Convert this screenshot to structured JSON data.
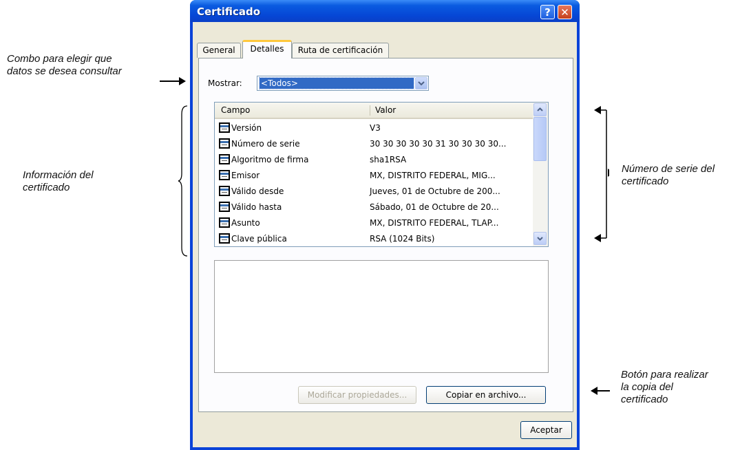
{
  "window": {
    "title": "Certificado",
    "help_label": "?",
    "close_label": "✕"
  },
  "tabs": [
    {
      "label": "General"
    },
    {
      "label": "Detalles"
    },
    {
      "label": "Ruta de certificación"
    }
  ],
  "show": {
    "label": "Mostrar:",
    "selected": "<Todos>"
  },
  "list": {
    "columns": [
      "Campo",
      "Valor"
    ],
    "rows": [
      {
        "field": "Versión",
        "value": "V3"
      },
      {
        "field": "Número de serie",
        "value": "30 30 30 30 30 31 30 30 30 30..."
      },
      {
        "field": "Algoritmo de firma",
        "value": "sha1RSA"
      },
      {
        "field": "Emisor",
        "value": "MX, DISTRITO FEDERAL, MIG..."
      },
      {
        "field": "Válido desde",
        "value": "Jueves, 01 de Octubre de 200..."
      },
      {
        "field": "Válido hasta",
        "value": "Sábado, 01 de Octubre de 20..."
      },
      {
        "field": "Asunto",
        "value": "MX, DISTRITO FEDERAL, TLAP..."
      },
      {
        "field": "Clave pública",
        "value": "RSA (1024 Bits)"
      }
    ]
  },
  "buttons": {
    "modificar": "Modificar propiedades...",
    "copiar": "Copiar en archivo...",
    "aceptar": "Aceptar"
  },
  "annotations": {
    "combo_line1": "Combo para elegir que",
    "combo_line2": "datos se desea consultar",
    "info_line1": "Información del",
    "info_line2": "certificado",
    "serie_line1": "Número de serie del",
    "serie_line2": "certificado",
    "boton_line1": "Botón para realizar",
    "boton_line2": "la copia del",
    "boton_line3": "certificado"
  }
}
